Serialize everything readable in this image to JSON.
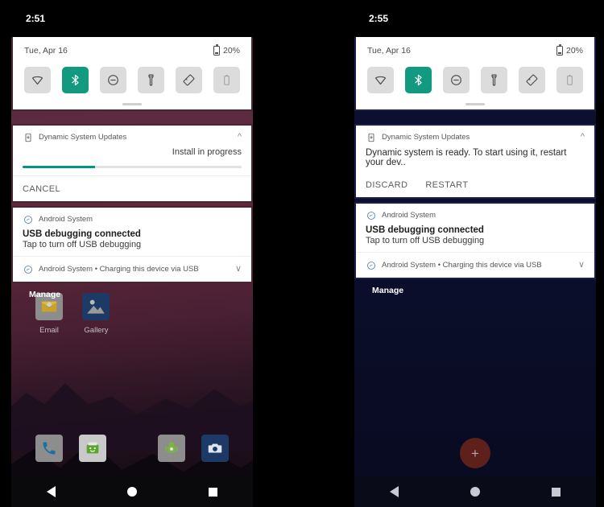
{
  "panels": [
    {
      "id": "left",
      "status": {
        "time": "2:51"
      },
      "quick_settings": {
        "date": "Tue, Apr 16",
        "battery": "20%",
        "battery_icon": "battery-icon",
        "tiles": [
          {
            "name": "wifi",
            "icon": "wifi-icon",
            "state": "off"
          },
          {
            "name": "bluetooth",
            "icon": "bluetooth-icon",
            "state": "on"
          },
          {
            "name": "do-not-disturb",
            "icon": "do-not-disturb-icon",
            "state": "off"
          },
          {
            "name": "flashlight",
            "icon": "flashlight-icon",
            "state": "off"
          },
          {
            "name": "auto-rotate",
            "icon": "auto-rotate-icon",
            "state": "off"
          },
          {
            "name": "battery-saver",
            "icon": "battery-saver-icon",
            "state": "disabled"
          }
        ]
      },
      "notifications": [
        {
          "kind": "progress",
          "app": "Dynamic System Updates",
          "app_icon": "system-update-icon",
          "expand_icon": "chevron-up-icon",
          "status_text": "Install in progress",
          "progress_percent": 33,
          "progress_color": "#009688",
          "actions": [
            "CANCEL"
          ]
        },
        {
          "kind": "standard",
          "app": "Android System",
          "app_icon": "android-system-icon",
          "title": "USB debugging connected",
          "text": "Tap to turn off USB debugging"
        },
        {
          "kind": "group",
          "app": "Android System • Charging this device via USB",
          "app_icon": "android-system-icon",
          "expand_icon": "chevron-down-icon"
        }
      ],
      "manage_label": "Manage",
      "home": {
        "apps": [
          {
            "label": "Email",
            "icon": "email-icon"
          },
          {
            "label": "Gallery",
            "icon": "gallery-icon"
          }
        ],
        "dock": [
          {
            "label": "Phone",
            "icon": "phone-icon"
          },
          {
            "label": "Messaging",
            "icon": "messaging-icon"
          },
          {
            "label": "Settings",
            "icon": "android-settings-icon"
          },
          {
            "label": "Camera",
            "icon": "camera-icon"
          }
        ]
      },
      "navbar": [
        {
          "name": "back",
          "icon": "back-triangle-icon"
        },
        {
          "name": "home",
          "icon": "home-circle-icon"
        },
        {
          "name": "recents",
          "icon": "recents-square-icon"
        }
      ]
    },
    {
      "id": "right",
      "status": {
        "time": "2:55"
      },
      "quick_settings": {
        "date": "Tue, Apr 16",
        "battery": "20%",
        "battery_icon": "battery-icon",
        "tiles": [
          {
            "name": "wifi",
            "icon": "wifi-icon",
            "state": "off"
          },
          {
            "name": "bluetooth",
            "icon": "bluetooth-icon",
            "state": "on"
          },
          {
            "name": "do-not-disturb",
            "icon": "do-not-disturb-icon",
            "state": "off"
          },
          {
            "name": "flashlight",
            "icon": "flashlight-icon",
            "state": "off"
          },
          {
            "name": "auto-rotate",
            "icon": "auto-rotate-icon",
            "state": "off"
          },
          {
            "name": "battery-saver",
            "icon": "battery-saver-icon",
            "state": "disabled"
          }
        ]
      },
      "notifications": [
        {
          "kind": "ready",
          "app": "Dynamic System Updates",
          "app_icon": "system-update-icon",
          "expand_icon": "chevron-up-icon",
          "text": "Dynamic system is ready. To start using it, restart your dev..",
          "actions": [
            "DISCARD",
            "RESTART"
          ]
        },
        {
          "kind": "standard",
          "app": "Android System",
          "app_icon": "android-system-icon",
          "title": "USB debugging connected",
          "text": "Tap to turn off USB debugging"
        },
        {
          "kind": "group",
          "app": "Android System • Charging this device via USB",
          "app_icon": "android-system-icon",
          "expand_icon": "chevron-down-icon"
        }
      ],
      "manage_label": "Manage",
      "fab": {
        "icon": "plus-icon",
        "label": "+",
        "color": "#5d201a"
      },
      "navbar": [
        {
          "name": "back",
          "icon": "back-triangle-icon"
        },
        {
          "name": "home",
          "icon": "home-circle-icon"
        },
        {
          "name": "recents",
          "icon": "recents-square-icon"
        }
      ]
    }
  ]
}
